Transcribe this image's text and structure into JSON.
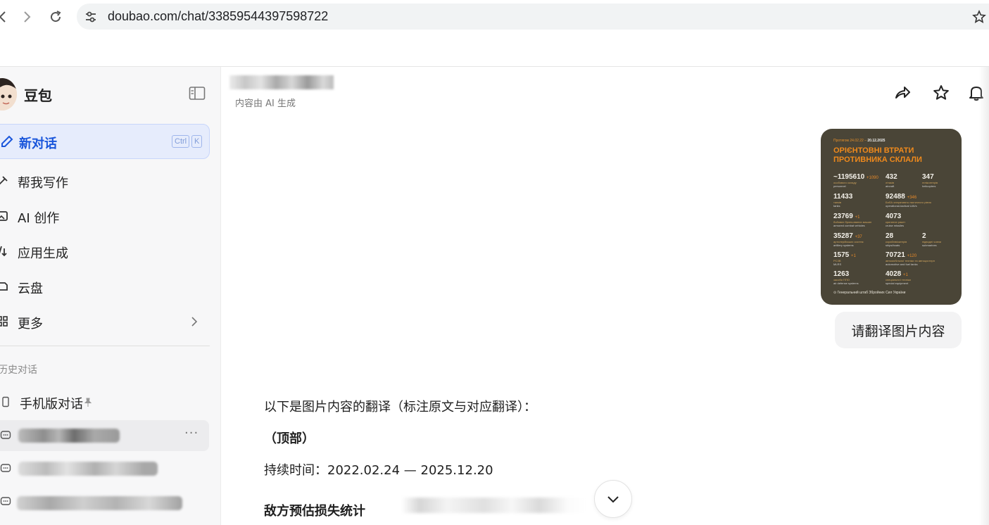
{
  "browser": {
    "url": "doubao.com/chat/33859544397598722"
  },
  "sidebar": {
    "brand_name": "豆包",
    "new_chat": {
      "label": "新对话",
      "shortcut_ctrl": "Ctrl",
      "shortcut_key": "K"
    },
    "menu": [
      {
        "label": "帮我写作",
        "icon": "pen-sparkle-icon"
      },
      {
        "label": "AI 创作",
        "icon": "image-sparkle-icon"
      },
      {
        "label": "应用生成",
        "icon": "app-build-icon"
      },
      {
        "label": "云盘",
        "icon": "cloud-drive-icon"
      },
      {
        "label": "更多",
        "icon": "grid-icon"
      }
    ],
    "history_title": "历史对话",
    "history": [
      {
        "label": "手机版对话",
        "pinned": true
      }
    ]
  },
  "main": {
    "ai_note": "内容由 AI 生成",
    "poster": {
      "period_prefix": "Протягом 24.02.22 –",
      "period_end": "20.12.2025",
      "title_line1": "ОРІЄНТОВНІ ВТРАТИ",
      "title_line2": "ПРОТИВНИКА СКЛАЛИ",
      "stats": [
        {
          "value": "~1195610",
          "delta": "+1090",
          "label_ua": "особового складу",
          "label_en": "personnel"
        },
        {
          "value": "432",
          "delta": "",
          "label_ua": "літаків",
          "label_en": "aircraft"
        },
        {
          "value": "347",
          "delta": "",
          "label_ua": "гелікоптерів",
          "label_en": "helicopters"
        },
        {
          "value": "11433",
          "delta": "",
          "label_ua": "танків",
          "label_en": "tanks"
        },
        {
          "value": "92488",
          "delta": "+346",
          "label_ua": "БпЛА оперативно-тактичного рівня",
          "label_en": "operational-tactical UAVs"
        },
        {
          "value": "23769",
          "delta": "+1",
          "label_ua": "бойових броньованих машин",
          "label_en": "armored combat vehicles"
        },
        {
          "value": "4073",
          "delta": "",
          "label_ua": "крилатих ракет",
          "label_en": "cruise missiles"
        },
        {
          "value": "35287",
          "delta": "+37",
          "label_ua": "артилерійських систем",
          "label_en": "artillery systems"
        },
        {
          "value": "28",
          "delta": "",
          "label_ua": "кораблів/катерів",
          "label_en": "ships/boats"
        },
        {
          "value": "2",
          "delta": "",
          "label_ua": "підводні човни",
          "label_en": "submarines"
        },
        {
          "value": "1575",
          "delta": "+1",
          "label_ua": "РСЗВ",
          "label_en": "MLRS"
        },
        {
          "value": "70721",
          "delta": "+120",
          "label_ua": "автомобільної техніки та автоцистерн",
          "label_en": "automotive and fuel tanks"
        },
        {
          "value": "1263",
          "delta": "",
          "label_ua": "засоби ППО",
          "label_en": "air defense systems"
        },
        {
          "value": "4028",
          "delta": "+1",
          "label_ua": "спеціальної техніки",
          "label_en": "special equipment"
        }
      ],
      "footer": "Генеральний штаб Збройних Сил України"
    },
    "user_message": "请翻译图片内容",
    "answer_intro": "以下是图片内容的翻译（标注原文与对应翻译）：",
    "answer_section": "（顶部）",
    "answer_duration": "持续时间：2022.02.24 — 2025.12.20",
    "answer_heading": "敌方预估损失统计"
  }
}
